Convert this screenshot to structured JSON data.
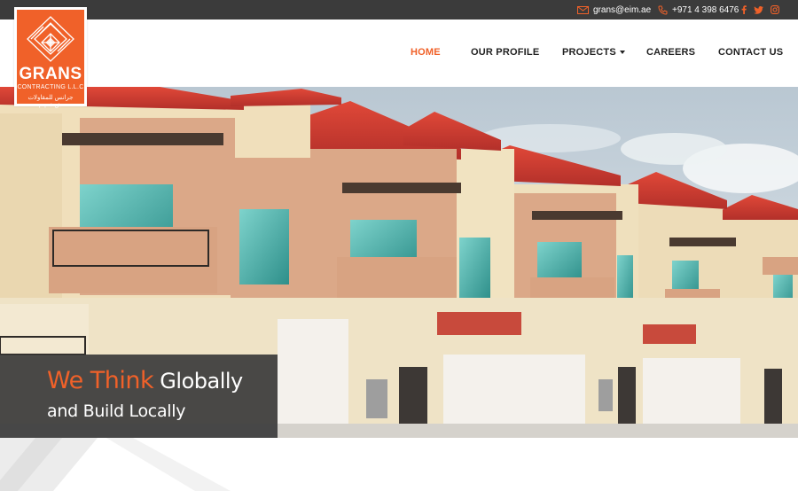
{
  "topbar": {
    "email": "grans@eim.ae",
    "phone": "+971 4 398 6476",
    "icons": [
      "email-icon",
      "phone-icon",
      "facebook-icon",
      "twitter-icon",
      "instagram-icon"
    ]
  },
  "logo": {
    "word": "GRANS",
    "sub": "CONTRACTING L.L.C",
    "arabic": "جرانس للمقاولات ش.ذ.م.م"
  },
  "nav": {
    "home": "HOME",
    "profile": "OUR PROFILE",
    "projects": "PROJECTS",
    "careers": "CAREERS",
    "contact": "CONTACT US"
  },
  "hero": {
    "tagline_accent": "We Think",
    "tagline_rest": " Globally",
    "tagline_line2": "and Build Locally"
  },
  "colors": {
    "accent": "#f06129",
    "topbar": "#3b3b3b",
    "text": "#222222"
  }
}
